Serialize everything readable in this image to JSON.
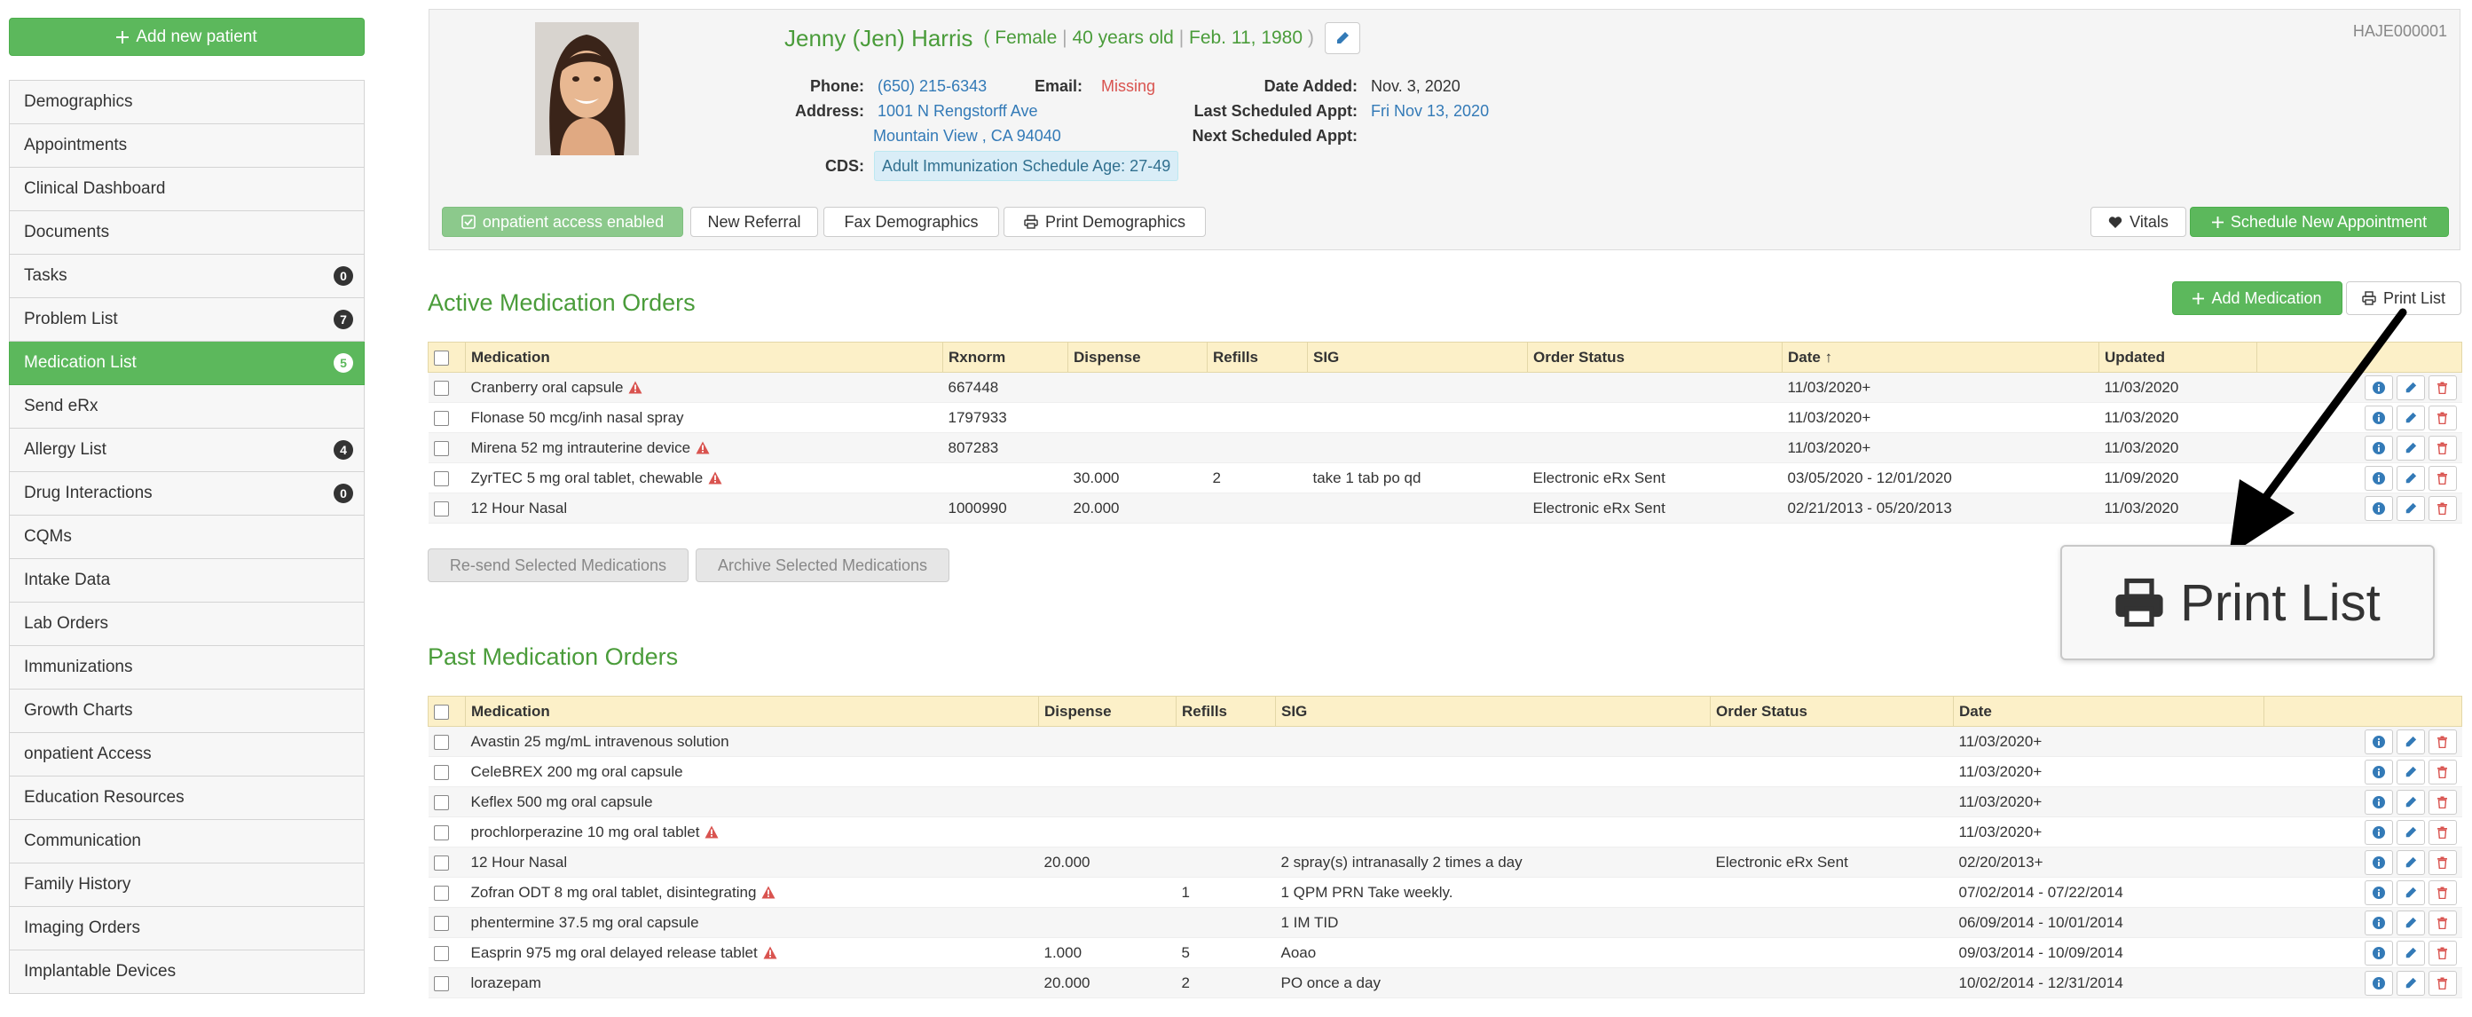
{
  "sidebar": {
    "add_patient_label": "Add new patient",
    "items": [
      {
        "label": "Demographics",
        "badge": null
      },
      {
        "label": "Appointments",
        "badge": null
      },
      {
        "label": "Clinical Dashboard",
        "badge": null
      },
      {
        "label": "Documents",
        "badge": null
      },
      {
        "label": "Tasks",
        "badge": "0"
      },
      {
        "label": "Problem List",
        "badge": "7"
      },
      {
        "label": "Medication List",
        "badge": "5"
      },
      {
        "label": "Send eRx",
        "badge": null
      },
      {
        "label": "Allergy List",
        "badge": "4"
      },
      {
        "label": "Drug Interactions",
        "badge": "0"
      },
      {
        "label": "CQMs",
        "badge": null
      },
      {
        "label": "Intake Data",
        "badge": null
      },
      {
        "label": "Lab Orders",
        "badge": null
      },
      {
        "label": "Immunizations",
        "badge": null
      },
      {
        "label": "Growth Charts",
        "badge": null
      },
      {
        "label": "onpatient Access",
        "badge": null
      },
      {
        "label": "Education Resources",
        "badge": null
      },
      {
        "label": "Communication",
        "badge": null
      },
      {
        "label": "Family History",
        "badge": null
      },
      {
        "label": "Imaging Orders",
        "badge": null
      },
      {
        "label": "Implantable Devices",
        "badge": null
      }
    ]
  },
  "patient": {
    "name": "Jenny (Jen) Harris",
    "open_paren": "(",
    "sex": "Female",
    "age": "40 years old",
    "dob": "Feb. 11, 1980",
    "close_paren": ")",
    "sep": "|",
    "id": "HAJE000001",
    "phone_label": "Phone:",
    "phone": "(650) 215-6343",
    "email_label": "Email:",
    "email": "Missing",
    "address_label": "Address:",
    "address_line1": "1001 N Rengstorff Ave",
    "address_line2": "Mountain View , CA 94040",
    "cds_label": "CDS:",
    "cds": "Adult Immunization Schedule Age: 27-49",
    "date_added_label": "Date Added:",
    "date_added": "Nov. 3, 2020",
    "last_appt_label": "Last Scheduled Appt:",
    "last_appt": "Fri Nov 13, 2020",
    "next_appt_label": "Next Scheduled Appt:",
    "next_appt": ""
  },
  "header_buttons": {
    "onpatient": "onpatient access enabled",
    "new_referral": "New Referral",
    "fax_demographics": "Fax Demographics",
    "print_demographics": "Print Demographics",
    "vitals": "Vitals",
    "schedule": "Schedule New Appointment"
  },
  "active": {
    "title": "Active Medication Orders",
    "add_medication": "Add Medication",
    "print_list": "Print List",
    "columns": [
      "Medication",
      "Rxnorm",
      "Dispense",
      "Refills",
      "SIG",
      "Order Status",
      "Date ↑",
      "Updated"
    ],
    "rows": [
      {
        "med": "Cranberry oral capsule",
        "warn": true,
        "rxnorm": "667448",
        "dispense": "",
        "refills": "",
        "sig": "",
        "status": "",
        "date": "11/03/2020+",
        "updated": "11/03/2020"
      },
      {
        "med": "Flonase 50 mcg/inh nasal spray",
        "warn": false,
        "rxnorm": "1797933",
        "dispense": "",
        "refills": "",
        "sig": "",
        "status": "",
        "date": "11/03/2020+",
        "updated": "11/03/2020"
      },
      {
        "med": "Mirena 52 mg intrauterine device",
        "warn": true,
        "rxnorm": "807283",
        "dispense": "",
        "refills": "",
        "sig": "",
        "status": "",
        "date": "11/03/2020+",
        "updated": "11/03/2020"
      },
      {
        "med": "ZyrTEC 5 mg oral tablet, chewable",
        "warn": true,
        "rxnorm": "",
        "dispense": "30.000",
        "refills": "2",
        "sig": "take 1 tab po qd",
        "status": "Electronic eRx Sent",
        "date": "03/05/2020 - 12/01/2020",
        "updated": "11/09/2020"
      },
      {
        "med": "12 Hour Nasal",
        "warn": false,
        "rxnorm": "1000990",
        "dispense": "20.000",
        "refills": "",
        "sig": "",
        "status": "Electronic eRx Sent",
        "date": "02/21/2013 - 05/20/2013",
        "updated": "11/03/2020"
      }
    ],
    "resend": "Re-send Selected Medications",
    "archive": "Archive Selected Medications"
  },
  "past": {
    "title": "Past Medication Orders",
    "columns": [
      "Medication",
      "Dispense",
      "Refills",
      "SIG",
      "Order Status",
      "Date"
    ],
    "rows": [
      {
        "med": "Avastin 25 mg/mL intravenous solution",
        "warn": false,
        "dispense": "",
        "refills": "",
        "sig": "",
        "status": "",
        "date": "11/03/2020+"
      },
      {
        "med": "CeleBREX 200 mg oral capsule",
        "warn": false,
        "dispense": "",
        "refills": "",
        "sig": "",
        "status": "",
        "date": "11/03/2020+"
      },
      {
        "med": "Keflex 500 mg oral capsule",
        "warn": false,
        "dispense": "",
        "refills": "",
        "sig": "",
        "status": "",
        "date": "11/03/2020+"
      },
      {
        "med": "prochlorperazine 10 mg oral tablet",
        "warn": true,
        "dispense": "",
        "refills": "",
        "sig": "",
        "status": "",
        "date": "11/03/2020+"
      },
      {
        "med": "12 Hour Nasal",
        "warn": false,
        "dispense": "20.000",
        "refills": "",
        "sig": "2 spray(s) intranasally 2 times a day",
        "status": "Electronic eRx Sent",
        "date": "02/20/2013+"
      },
      {
        "med": "Zofran ODT 8 mg oral tablet, disintegrating",
        "warn": true,
        "dispense": "",
        "refills": "1",
        "sig": "1 QPM PRN Take weekly.",
        "status": "",
        "date": "07/02/2014 - 07/22/2014"
      },
      {
        "med": "phentermine 37.5 mg oral capsule",
        "warn": false,
        "dispense": "",
        "refills": "",
        "sig": "1 IM TID",
        "status": "",
        "date": "06/09/2014 - 10/01/2014"
      },
      {
        "med": "Easprin 975 mg oral delayed release tablet",
        "warn": true,
        "dispense": "1.000",
        "refills": "5",
        "sig": "Aoao",
        "status": "",
        "date": "09/03/2014 - 10/09/2014"
      },
      {
        "med": "lorazepam",
        "warn": false,
        "dispense": "20.000",
        "refills": "2",
        "sig": "PO once a day",
        "status": "",
        "date": "10/02/2014 - 12/31/2014"
      }
    ]
  },
  "callout": {
    "label": "Print List"
  },
  "colors": {
    "brand_green": "#5cb85c",
    "title_green": "#4a9c3a",
    "link_blue": "#337ab7",
    "danger_red": "#d9534f",
    "table_header": "#fcf0c8"
  }
}
